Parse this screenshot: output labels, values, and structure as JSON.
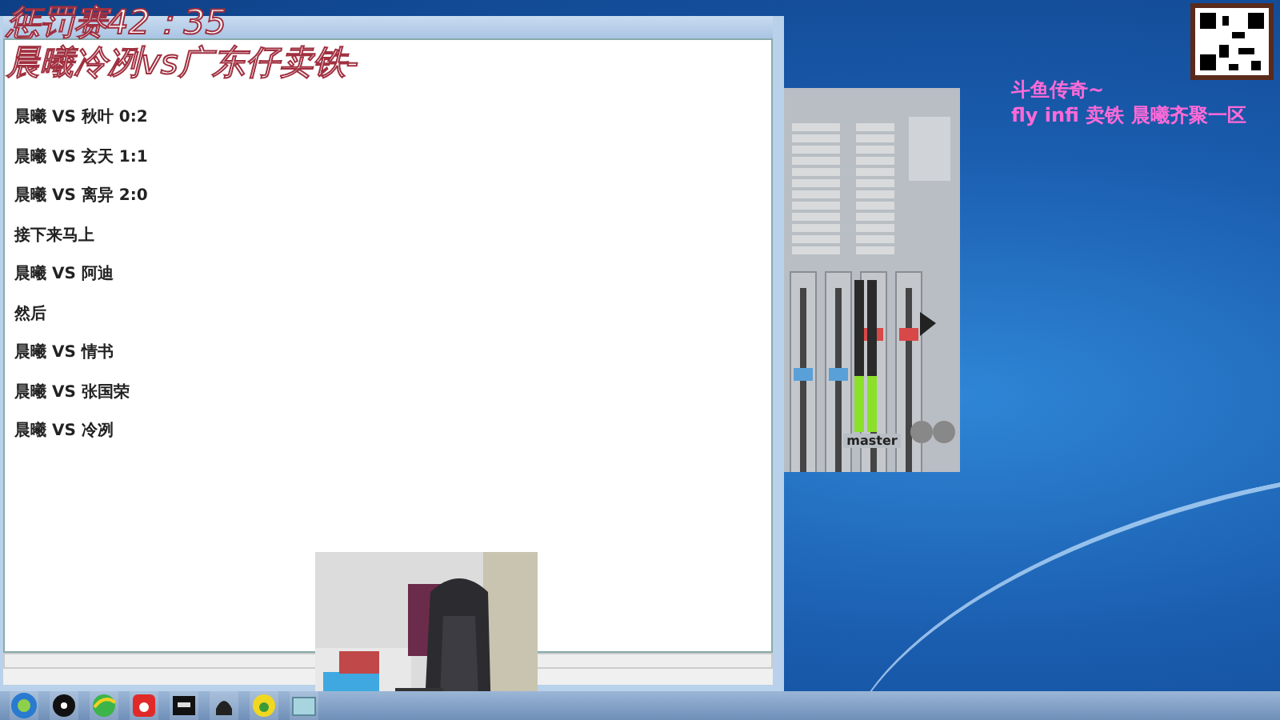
{
  "overlay_title": {
    "line_1": "惩罚赛42：35",
    "line_2": "晨曦冷冽vs广东仔卖铁-"
  },
  "editor": {
    "lines": [
      "晨曦 VS 秋叶 0:2",
      "晨曦 VS 玄天 1:1",
      "晨曦 VS 离异 2:0",
      "接下来马上",
      "晨曦 VS 阿迪",
      "然后",
      "晨曦 VS 情书",
      "晨曦 VS 张国荣",
      "晨曦 VS 冷冽"
    ]
  },
  "mixer": {
    "label": "master"
  },
  "overlay_caption": {
    "line_1": "斗鱼传奇~",
    "line_2": "fly infi 卖铁 晨曦齐聚一区"
  },
  "taskbar": {
    "apps": [
      {
        "kind": "start"
      },
      {
        "kind": "media"
      },
      {
        "kind": "browser"
      },
      {
        "kind": "six"
      },
      {
        "kind": "video"
      },
      {
        "kind": "headset"
      },
      {
        "kind": "music"
      },
      {
        "kind": "window"
      }
    ]
  }
}
